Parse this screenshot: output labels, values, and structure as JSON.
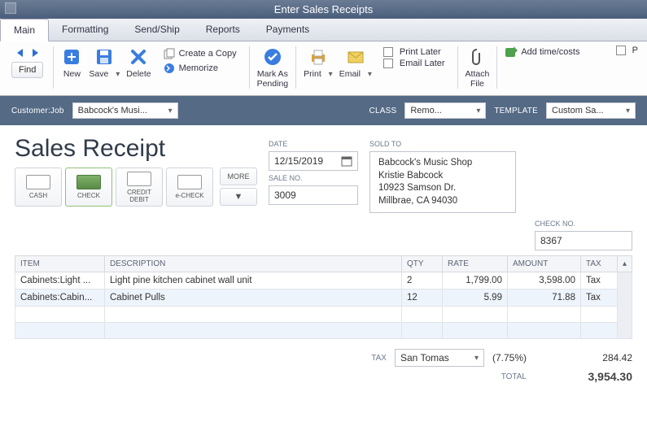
{
  "window": {
    "title": "Enter Sales Receipts"
  },
  "tabs": {
    "main": "Main",
    "formatting": "Formatting",
    "sendship": "Send/Ship",
    "reports": "Reports",
    "payments": "Payments"
  },
  "ribbon": {
    "find": "Find",
    "new": "New",
    "save": "Save",
    "delete": "Delete",
    "create_copy": "Create a Copy",
    "memorize": "Memorize",
    "mark_pending": "Mark As\nPending",
    "print": "Print",
    "email": "Email",
    "print_later": "Print Later",
    "email_later": "Email Later",
    "attach_file": "Attach\nFile",
    "add_time_costs": "Add time/costs",
    "p": "P"
  },
  "selectors": {
    "customer_label": "Customer:Job",
    "customer_value": "Babcock's Musi...",
    "class_label": "Class",
    "class_value": "Remo...",
    "template_label": "Template",
    "template_value": "Custom Sa..."
  },
  "heading": "Sales Receipt",
  "pay": {
    "cash": "CASH",
    "check": "CHECK",
    "credit": "CREDIT\nDEBIT",
    "echeck": "e-CHECK",
    "more": "MORE"
  },
  "fields": {
    "date_label": "Date",
    "date_value": "12/15/2019",
    "sale_no_label": "Sale No.",
    "sale_no_value": "3009",
    "sold_to_label": "Sold To",
    "sold_to_lines": {
      "l1": "Babcock's Music Shop",
      "l2": "Kristie Babcock",
      "l3": "10923 Samson Dr.",
      "l4": "Millbrae, CA 94030"
    },
    "check_no_label": "Check No.",
    "check_no_value": "8367"
  },
  "columns": {
    "item": "Item",
    "desc": "Description",
    "qty": "Qty",
    "rate": "Rate",
    "amount": "Amount",
    "tax": "Tax"
  },
  "lines": [
    {
      "item": "Cabinets:Light ...",
      "desc": "Light pine kitchen cabinet wall unit",
      "qty": "2",
      "rate": "1,799.00",
      "amount": "3,598.00",
      "tax": "Tax"
    },
    {
      "item": "Cabinets:Cabin...",
      "desc": "Cabinet Pulls",
      "qty": "12",
      "rate": "5.99",
      "amount": "71.88",
      "tax": "Tax"
    }
  ],
  "totals": {
    "tax_label": "Tax",
    "tax_jurisdiction": "San Tomas",
    "tax_rate": "(7.75%)",
    "tax_amount": "284.42",
    "total_label": "Total",
    "total_amount": "3,954.30"
  }
}
